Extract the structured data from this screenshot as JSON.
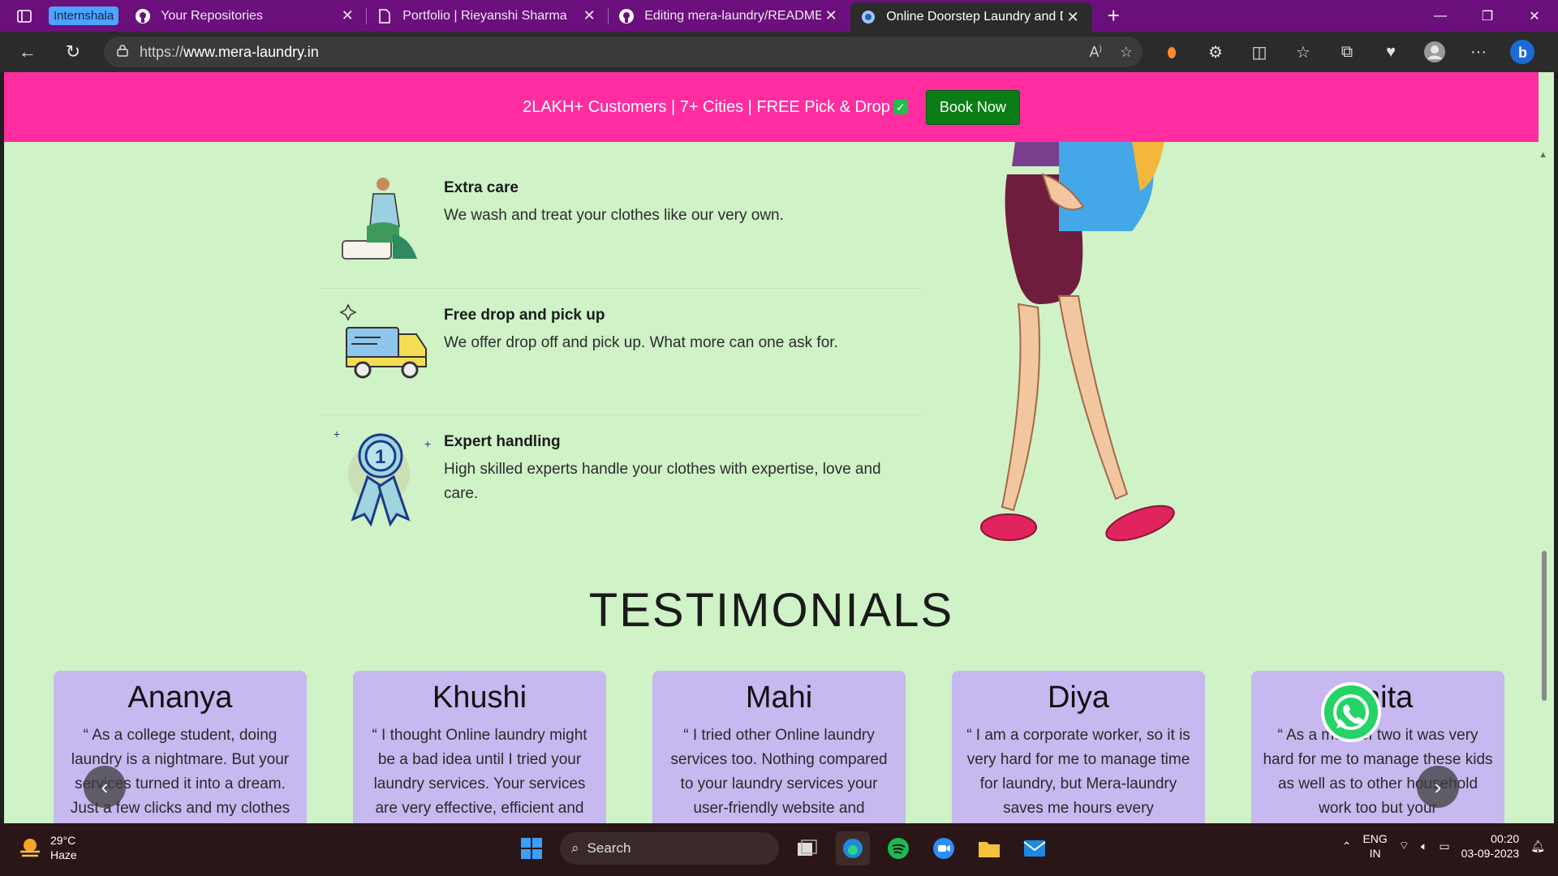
{
  "browser": {
    "tab_group_label": "Internshala",
    "tabs": [
      {
        "title": "Your Repositories"
      },
      {
        "title": "Portfolio | Rieyanshi Sharma"
      },
      {
        "title": "Editing mera-laundry/README.md"
      },
      {
        "title": "Online Doorstep Laundry and Dry Cleaning"
      }
    ],
    "url_prefix": "https://",
    "url_host": "www.mera-laundry.in"
  },
  "promo": {
    "text": "2LAKH+ Customers | 7+ Cities | FREE Pick & Drop",
    "check": "✓",
    "button": "Book Now"
  },
  "features": [
    {
      "title": "Extra care",
      "desc": "We wash and treat your clothes like our very own.",
      "icon": "washing-person-icon"
    },
    {
      "title": "Free drop and pick up",
      "desc": "We offer drop off and pick up. What more can one ask for.",
      "icon": "delivery-truck-icon"
    },
    {
      "title": "Expert handling",
      "desc": "High skilled experts handle your clothes with expertise, love and care.",
      "icon": "medal-icon"
    }
  ],
  "testimonials": {
    "title": "TESTIMONIALS",
    "cards": [
      {
        "name": "Ananya",
        "quote": "“ As a college student, doing laundry is a nightmare. But your services turned it into a dream. Just a few clicks and my clothes"
      },
      {
        "name": "Khushi",
        "quote": "“ I thought Online laundry might be a bad idea until I tried your laundry services. Your services are very effective, efficient and"
      },
      {
        "name": "Mahi",
        "quote": "“ I tried other Online laundry services too. Nothing compared to your laundry services your user-friendly website and"
      },
      {
        "name": "Diya",
        "quote": "“ I am a corporate worker, so it is very hard for me to manage time for laundry, but Mera-laundry saves me hours every"
      },
      {
        "name": "Anita",
        "quote": "“ As a mom of two it was very hard for me to manage these kids as well as to other household work too but your"
      }
    ]
  },
  "taskbar": {
    "weather_temp": "29°C",
    "weather_desc": "Haze",
    "search_placeholder": "Search",
    "lang_line1": "ENG",
    "lang_line2": "IN",
    "time": "00:20",
    "date": "03-09-2023"
  },
  "colors": {
    "promo_bg": "#ff2da0",
    "page_bg": "#cff2c6",
    "card_bg": "#c7b8f0",
    "book_btn": "#0b7d16",
    "tab_strip": "#6b0f7c"
  }
}
